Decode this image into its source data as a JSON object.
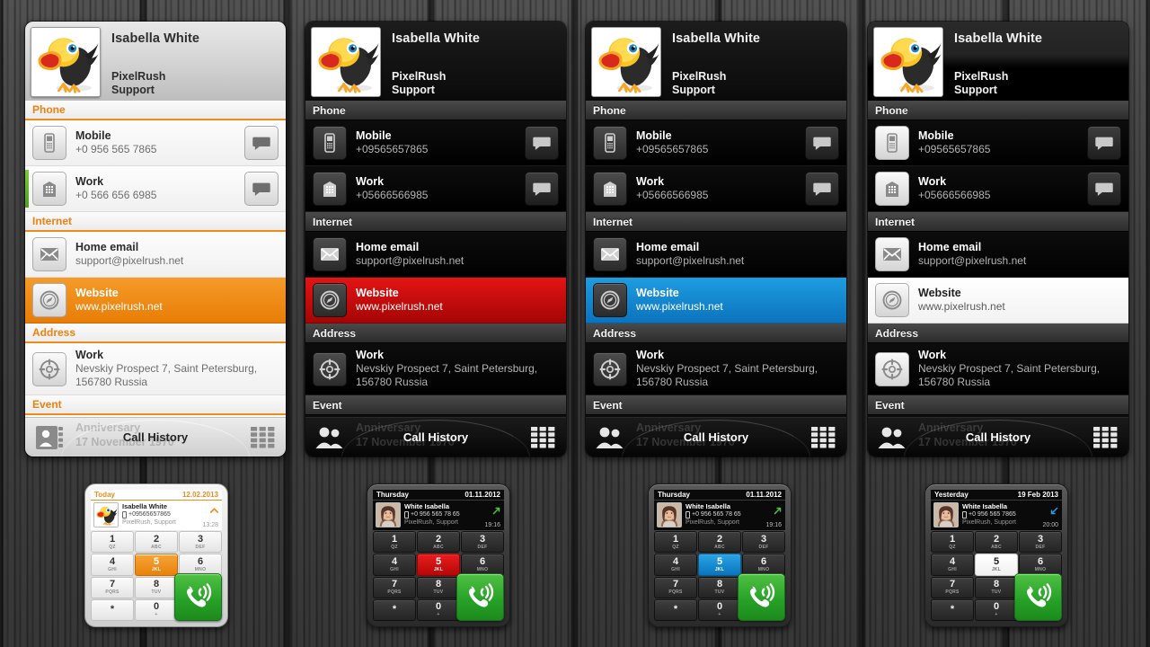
{
  "contact": {
    "name": "Isabella White",
    "org_line1": "PixelRush",
    "org_line2": "Support",
    "footer_label": "Call History",
    "ghost_label": "Anniversary",
    "ghost_value": "17 November 1970"
  },
  "sections": {
    "phone": "Phone",
    "internet": "Internet",
    "address": "Address",
    "event": "Event"
  },
  "rows": {
    "mobile_label": "Mobile",
    "work_phone_label": "Work",
    "home_email_label": "Home email",
    "home_email_value": "support@pixelrush.net",
    "website_label": "Website",
    "website_value": "www.pixelrush.net",
    "work_addr_label": "Work",
    "work_addr_value": "Nevskiy Prospect 7, Saint Petersburg, 156780 Russia",
    "anniversary_label": "Anniversary",
    "anniversary_value": "17 November 1970"
  },
  "cards": [
    {
      "theme": "light",
      "accent": "#e87d06",
      "selected_row": "website",
      "mobile_value": "+0 956 565 7865",
      "work_phone_value": "+0 566 656 6985"
    },
    {
      "theme": "dark",
      "accent": "#d01212",
      "selected_row": "website",
      "mobile_value": "+09565657865",
      "work_phone_value": "+05666566985"
    },
    {
      "theme": "dark",
      "accent": "#0b87d4",
      "selected_row": "website",
      "mobile_value": "+09565657865",
      "work_phone_value": "+05666566985"
    },
    {
      "theme": "dark",
      "accent": "#ffffff",
      "selected_row": "website",
      "mobile_value": "+09565657865",
      "work_phone_value": "+05666566985"
    }
  ],
  "keypad": {
    "keys": [
      {
        "digit": "1",
        "sub": "QZ"
      },
      {
        "digit": "2",
        "sub": "ABC"
      },
      {
        "digit": "3",
        "sub": "DEF"
      },
      {
        "digit": "4",
        "sub": "GHI"
      },
      {
        "digit": "5",
        "sub": "JKL"
      },
      {
        "digit": "6",
        "sub": "MNO"
      },
      {
        "digit": "7",
        "sub": "PQRS"
      },
      {
        "digit": "8",
        "sub": "TUV"
      },
      {
        "digit": "*",
        "sub": ""
      },
      {
        "digit": "0",
        "sub": "+"
      }
    ],
    "highlight_digit": "5"
  },
  "dialers": [
    {
      "shell": "light",
      "day": "Today",
      "date": "12.02.2013",
      "name": "Isabella White",
      "number": "+09565657865",
      "org": "PixelRush, Support",
      "time": "13:28",
      "highlight_color": "orange",
      "direction": "missed"
    },
    {
      "shell": "dark",
      "day": "Thursday",
      "date": "01.11.2012",
      "name": "White Isabella",
      "number": "+0 956 565 78 65",
      "org": "PixelRush,  Support",
      "time": "19:16",
      "highlight_color": "red",
      "direction": "outgoing"
    },
    {
      "shell": "dark",
      "day": "Thursday",
      "date": "01.11.2012",
      "name": "White Isabella",
      "number": "+0 956 565 78 65",
      "org": "PixelRush,  Support",
      "time": "19:16",
      "highlight_color": "blue",
      "direction": "outgoing"
    },
    {
      "shell": "dark",
      "day": "Yesterday",
      "date": "19 Feb 2013",
      "name": "White Isabella",
      "number": "+0 956 565 7865",
      "org": "PixelRush, Support",
      "time": "20:00",
      "highlight_color": "white",
      "direction": "incoming"
    }
  ],
  "icons": {
    "mobile": "mobile-phone-icon",
    "work": "office-building-icon",
    "email": "envelope-icon",
    "website": "compass-icon",
    "address": "target-icon",
    "event": "rings-icon",
    "message": "speech-bubble-icon",
    "contacts": "contacts-book-icon",
    "keypad": "keypad-grid-icon",
    "call": "phone-call-icon"
  }
}
